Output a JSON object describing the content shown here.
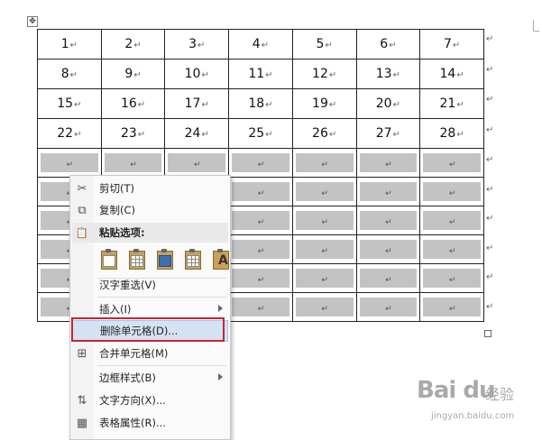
{
  "table": {
    "rows": [
      [
        "1",
        "2",
        "3",
        "4",
        "5",
        "6",
        "7"
      ],
      [
        "8",
        "9",
        "10",
        "11",
        "12",
        "13",
        "14"
      ],
      [
        "15",
        "16",
        "17",
        "18",
        "19",
        "20",
        "21"
      ],
      [
        "22",
        "23",
        "24",
        "25",
        "26",
        "27",
        "28"
      ]
    ],
    "blank_rows": 6,
    "columns": 7,
    "cell_mark": "↵",
    "row_end_mark": "↵"
  },
  "context_menu": {
    "items": [
      {
        "id": "cut",
        "label": "剪切(T)",
        "icon": "scissors-icon"
      },
      {
        "id": "copy",
        "label": "复制(C)",
        "icon": "copy-icon"
      },
      {
        "id": "paste_header",
        "label": "粘贴选项:",
        "icon": "paste-icon"
      },
      {
        "id": "hanzi",
        "label": "汉字重选(V)",
        "icon": ""
      },
      {
        "id": "insert",
        "label": "插入(I)",
        "icon": "",
        "submenu": true
      },
      {
        "id": "delete_cells",
        "label": "删除单元格(D)...",
        "icon": "",
        "highlighted": true
      },
      {
        "id": "merge_cells",
        "label": "合并单元格(M)",
        "icon": "merge-cells-icon"
      },
      {
        "id": "border_style",
        "label": "边框样式(B)",
        "icon": "",
        "submenu": true
      },
      {
        "id": "text_direction",
        "label": "文字方向(X)...",
        "icon": "text-direction-icon"
      },
      {
        "id": "table_props",
        "label": "表格属性(R)...",
        "icon": "table-properties-icon"
      }
    ],
    "paste_options": [
      "keep-source-formatting-icon",
      "merge-table-icon",
      "nest-table-icon",
      "insert-as-new-rows-icon",
      "keep-text-only-icon"
    ],
    "paste_text_letter": "A",
    "highlight_border_color": "#c4262e"
  },
  "watermark": {
    "logo": "Bai du",
    "cn": "经验",
    "url": "jingyan.baidu.com"
  }
}
